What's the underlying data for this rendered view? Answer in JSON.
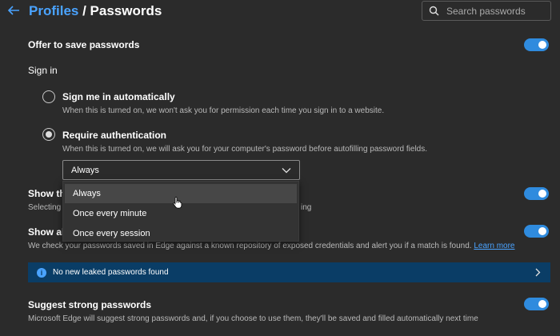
{
  "header": {
    "breadcrumb_parent": "Profiles",
    "breadcrumb_separator": " / ",
    "breadcrumb_current": "Passwords"
  },
  "search": {
    "placeholder": "Search passwords",
    "value": ""
  },
  "offer_to_save": {
    "label": "Offer to save passwords",
    "enabled": true
  },
  "sign_in": {
    "heading": "Sign in",
    "auto": {
      "label": "Sign me in automatically",
      "description": "When this is turned on, we won't ask you for permission each time you sign in to a website.",
      "checked": false
    },
    "require_auth": {
      "label": "Require authentication",
      "description": "When this is turned on, we will ask you for your computer's password before autofilling password fields.",
      "checked": true
    },
    "frequency_select": {
      "selected": "Always",
      "options": [
        "Always",
        "Once every minute",
        "Once every session"
      ],
      "highlighted_index": 0
    }
  },
  "show_reveal": {
    "label_visible": "Show the",
    "description_visible": "Selecting",
    "description_tail": "ing",
    "enabled": true
  },
  "show_alerts": {
    "label_visible": "Show ale",
    "description": "We check your passwords saved in Edge against a known repository of exposed credentials and alert you if a match is found.",
    "learn_more": "Learn more",
    "enabled": true
  },
  "leak_banner": {
    "text": "No new leaked passwords found"
  },
  "suggest_strong": {
    "label": "Suggest strong passwords",
    "description": "Microsoft Edge will suggest strong passwords and, if you choose to use them, they'll be saved and filled automatically next time",
    "enabled": true
  },
  "colors": {
    "background": "#2b2b2b",
    "accent": "#4aa3ff",
    "toggle_on": "#2f8bde",
    "banner": "#0a3d66"
  }
}
